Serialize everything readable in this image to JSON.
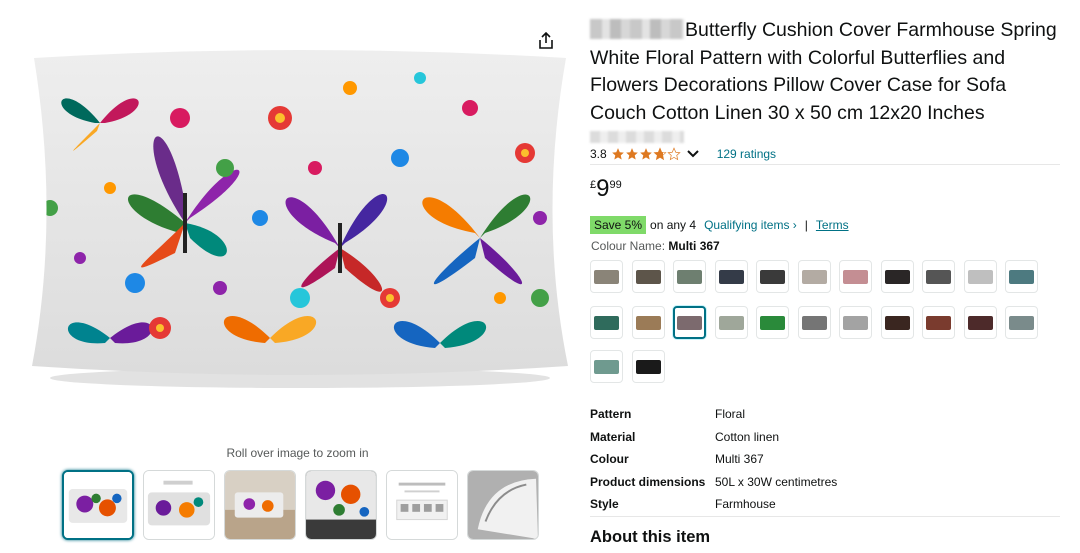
{
  "gallery": {
    "zoom_hint": "Roll over image to zoom in",
    "thumbnails": [
      {
        "alt": "butterfly-pillow-front"
      },
      {
        "alt": "butterfly-pillow-pair"
      },
      {
        "alt": "pillow-on-sofa"
      },
      {
        "alt": "pillow-closeup"
      },
      {
        "alt": "washing-instructions"
      },
      {
        "alt": "zipper-detail"
      }
    ],
    "selected_thumbnail": 0
  },
  "product": {
    "title": "Butterfly Cushion Cover Farmhouse Spring White Floral Pattern with Colorful Butterflies and Flowers Decorations Pillow Cover Case for Sofa Couch Cotton Linen 30 x 50 cm 12x20 Inches",
    "rating_value": "3.8",
    "stars": 3.8,
    "ratings_count": "129 ratings",
    "price": {
      "symbol": "£",
      "whole": "9",
      "fraction": "99"
    },
    "promo": {
      "badge": "Save 5%",
      "text": "on any 4",
      "link": "Qualifying items ›",
      "separator": "|",
      "terms": "Terms"
    },
    "colour_label": "Colour Name:",
    "colour_value": "Multi 367",
    "swatch_colors": [
      [
        "#8a8478",
        "#5d554a",
        "#6e7f70",
        "#343b48",
        "#3a3a3a",
        "#b3aba3",
        "#c48e93",
        "#2a2626",
        "#555555",
        "#bfbfbf",
        "#4d7a80"
      ],
      [
        "#2f6b5c",
        "#9b7b57",
        "#7c6a6e",
        "#9fa79a",
        "#2a8a3a",
        "#757575",
        "#a3a3a3",
        "#3a2620",
        "#7a3b2e",
        "#4d2a2a",
        "#7a8b8b"
      ],
      [
        "#6f9a8f",
        "#1a1a1a"
      ]
    ],
    "selected_swatch": "Multi 367",
    "specs": [
      {
        "key": "Pattern",
        "value": "Floral"
      },
      {
        "key": "Material",
        "value": "Cotton linen"
      },
      {
        "key": "Colour",
        "value": "Multi 367"
      },
      {
        "key": "Product dimensions",
        "value": "50L x 30W centimetres"
      },
      {
        "key": "Style",
        "value": "Farmhouse"
      }
    ],
    "about_heading": "About this item"
  },
  "colors": {
    "link": "#007185",
    "star": "#de7921",
    "save_badge": "#7fda69",
    "text": "#0f1111"
  }
}
